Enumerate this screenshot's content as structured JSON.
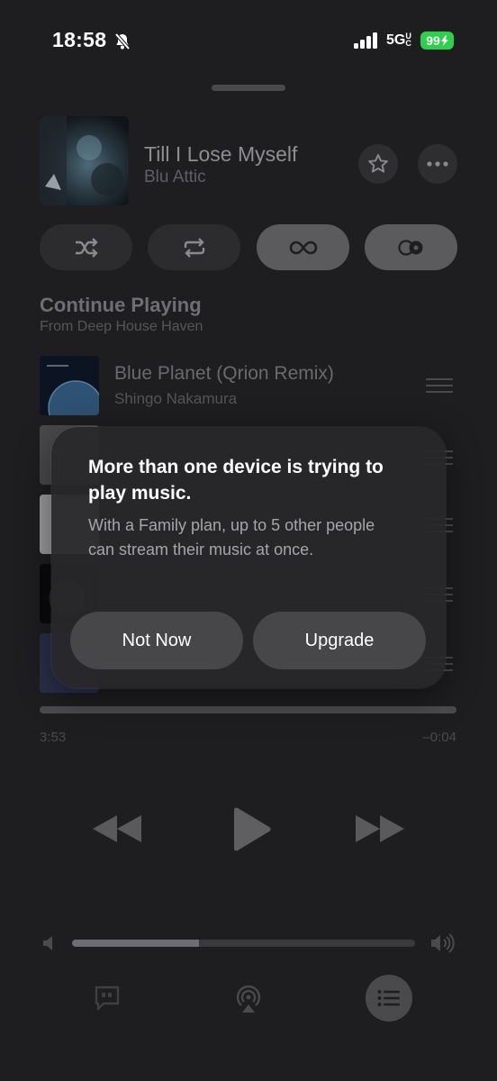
{
  "status_bar": {
    "time": "18:58",
    "network": "5G",
    "network_suffix": "UC",
    "battery": "99"
  },
  "now_playing": {
    "title": "Till I Lose Myself",
    "artist": "Blu Attic"
  },
  "controls": {
    "shuffle_icon": "shuffle-icon",
    "repeat_icon": "repeat-icon",
    "autoplay_icon": "infinity-icon",
    "crossfade_icon": "toggle-icon"
  },
  "queue": {
    "section_title": "Continue Playing",
    "section_subtitle": "From Deep House Haven",
    "items": [
      {
        "title": "Blue Planet (Qrion Remix)",
        "artist": "Shingo Nakamura"
      }
    ]
  },
  "playback": {
    "elapsed": "3:53",
    "remaining": "–0:04",
    "progress": 0.995
  },
  "volume": {
    "level": 0.37
  },
  "dialog": {
    "title": "More than one device is trying to play music.",
    "body": "With a Family plan, up to 5 other people can stream their music at once.",
    "not_now_label": "Not Now",
    "upgrade_label": "Upgrade"
  },
  "bottom_bar": [
    "lyrics-icon",
    "airplay-icon",
    "queue-icon"
  ]
}
